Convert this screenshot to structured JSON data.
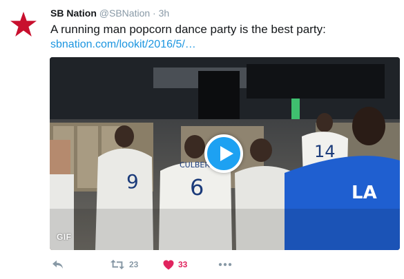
{
  "tweet": {
    "author_name": "SB Nation",
    "handle": "@SBNation",
    "separator": "·",
    "time": "3h",
    "text": "A running man popcorn dance party is the best party:",
    "link": "sbnation.com/lookit/2016/5/…",
    "media": {
      "badge": "GIF",
      "jersey_numbers": [
        "9",
        "6",
        "14"
      ],
      "jersey_name": "CULBERSON",
      "shirt_logo": "LA"
    },
    "actions": {
      "retweet_count": "23",
      "like_count": "33"
    }
  },
  "colors": {
    "link": "#1b95e0",
    "like": "#e0245e",
    "play_button": "#1da1f2",
    "avatar_star": "#c8102e",
    "muted": "#8899a6"
  },
  "icons": {
    "avatar": "red-star",
    "play": "play-triangle",
    "reply": "reply-arrow",
    "retweet": "retweet-arrows",
    "like": "heart",
    "more": "three-dots"
  }
}
